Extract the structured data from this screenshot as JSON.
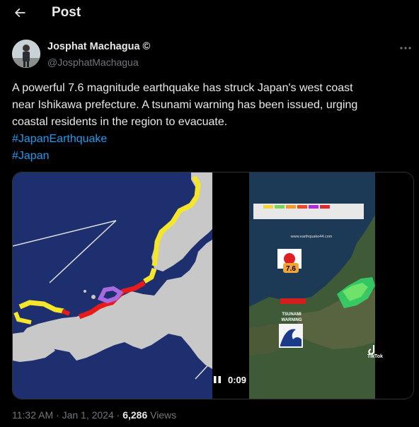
{
  "header": {
    "title": "Post",
    "back_icon": "arrow-left-icon"
  },
  "author": {
    "name": "Josphat Machagua ©",
    "handle": "@JosphatMachagua"
  },
  "tweet": {
    "lines": [
      "A powerful 7.6 magnitude earthquake  has struck Japan's west coast",
      "near Ishikawa prefecture. A tsunami warning has been issued, urging",
      "coastal residents in the region to evacuate."
    ],
    "hashtags": [
      "#JapanEarthquake",
      "#Japan"
    ]
  },
  "video": {
    "time": "0:09",
    "magnitude": "7.6",
    "url_text": "www.earthquake44.com",
    "tsunami_label": "TSUNAMI",
    "warning_label": "WARNING",
    "tiktok_label": "TikTok"
  },
  "meta": {
    "time": "11:32 AM",
    "date": "Jan 1, 2024",
    "separator": "·",
    "views": "6,286",
    "views_label": "Views"
  },
  "colors": {
    "background": "#000000",
    "text": "#e7e9ea",
    "secondary": "#71767b",
    "link": "#1d9bf0",
    "map_sea": "#1d2f6e",
    "map_land": "#c8c8c8"
  }
}
